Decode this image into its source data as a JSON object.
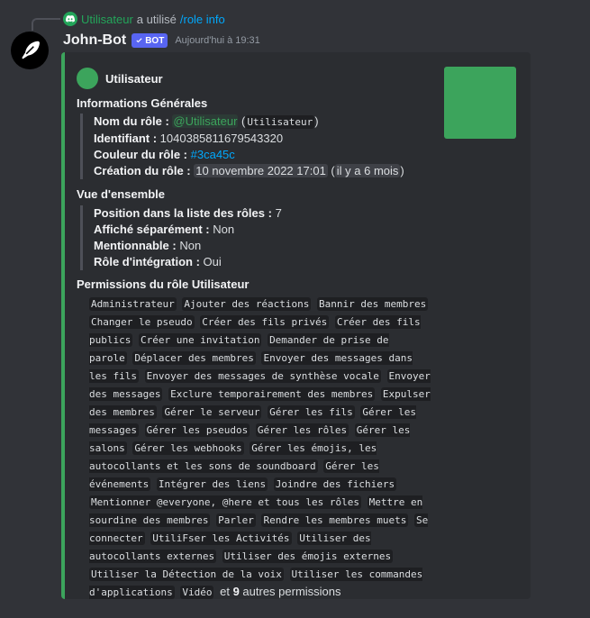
{
  "command": {
    "user": "Utilisateur",
    "used_text": "a utilisé",
    "command": "/role info"
  },
  "message": {
    "bot_name": "John-Bot",
    "badge": "BOT",
    "timestamp": "Aujourd'hui à 19:31"
  },
  "embed": {
    "accent_color": "#3ca45c",
    "author": "Utilisateur",
    "general": {
      "title": "Informations Générales",
      "name_label": "Nom du rôle :",
      "name_mention": "@Utilisateur",
      "name_code": "Utilisateur",
      "id_label": "Identifiant :",
      "id_value": "1040385811679543320",
      "color_label": "Couleur du rôle :",
      "color_value": "#3ca45c",
      "created_label": "Création du rôle :",
      "created_value": "10 novembre 2022 17:01",
      "created_relative": "il y a 6 mois"
    },
    "overview": {
      "title": "Vue d'ensemble",
      "position_label": "Position dans la liste des rôles :",
      "position_value": "7",
      "hoist_label": "Affiché séparément :",
      "hoist_value": "Non",
      "mentionable_label": "Mentionnable :",
      "mentionable_value": "Non",
      "integration_label": "Rôle d'intégration :",
      "integration_value": "Oui"
    },
    "permissions": {
      "title": "Permissions du rôle Utilisateur",
      "items": [
        "Administrateur",
        "Ajouter des réactions",
        "Bannir des membres",
        "Changer le pseudo",
        "Créer des fils privés",
        "Créer des fils publics",
        "Créer une invitation",
        "Demander de prise de parole",
        "Déplacer des membres",
        "Envoyer des messages dans les fils",
        "Envoyer des messages de synthèse vocale",
        "Envoyer des messages",
        "Exclure temporairement des membres",
        "Expulser des membres",
        "Gérer le serveur",
        "Gérer les fils",
        "Gérer les messages",
        "Gérer les pseudos",
        "Gérer les rôles",
        "Gérer les salons",
        "Gérer les webhooks",
        "Gérer les émojis, les autocollants et les sons de soundboard",
        "Gérer les événements",
        "Intégrer des liens",
        "Joindre des fichiers",
        "Mentionner @everyone, @here et tous les rôles",
        "Mettre en sourdine des membres",
        "Parler",
        "Rendre les membres muets",
        "Se connecter",
        "UtiliFser les Activités",
        "Utiliser des autocollants externes",
        "Utiliser des émojis externes",
        "Utiliser la Détection de la voix",
        "Utiliser les commandes d'applications",
        "Vidéo"
      ],
      "and_text": "et",
      "more_count": "9",
      "more_text": "autres permissions"
    }
  }
}
